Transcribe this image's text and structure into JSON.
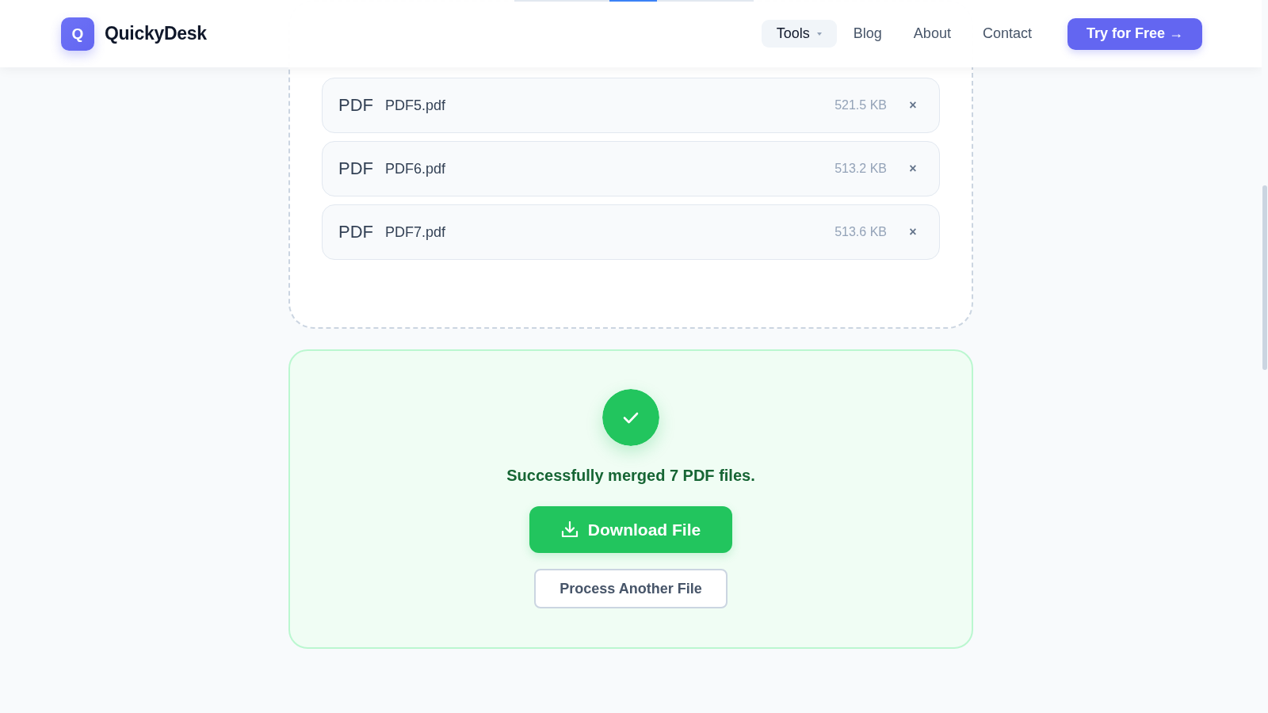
{
  "header": {
    "logo_letter": "Q",
    "brand": "QuickyDesk",
    "nav": [
      {
        "label": "Tools",
        "kind": "dropdown",
        "selected": true
      },
      {
        "label": "Blog",
        "kind": "link",
        "selected": false
      },
      {
        "label": "About",
        "kind": "link",
        "selected": false
      },
      {
        "label": "Contact",
        "kind": "link",
        "selected": false
      }
    ],
    "cta": "Try for Free →"
  },
  "files": [
    {
      "type_label": "PDF",
      "name": "PDF5.pdf",
      "size": "521.5 KB",
      "remove": "×"
    },
    {
      "type_label": "PDF",
      "name": "PDF6.pdf",
      "size": "513.2 KB",
      "remove": "×"
    },
    {
      "type_label": "PDF",
      "name": "PDF7.pdf",
      "size": "513.6 KB",
      "remove": "×"
    }
  ],
  "result": {
    "succeeded": true,
    "message": "Successfully merged 7 PDF files.",
    "primary_button": "Download File",
    "secondary_button": "Process Another File"
  }
}
